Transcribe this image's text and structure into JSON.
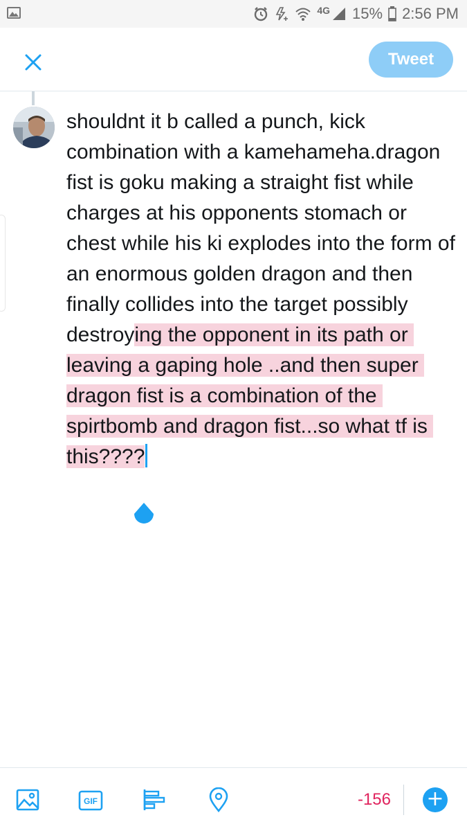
{
  "status_bar": {
    "battery": "15%",
    "time": "2:56 PM",
    "network": "4G",
    "icons": [
      "gallery-icon",
      "alarm-icon",
      "data-saver-icon",
      "wifi-icon",
      "signal-icon",
      "battery-icon"
    ]
  },
  "header": {
    "close_icon": "close-icon",
    "tweet_label": "Tweet",
    "tweet_button_color": "#8ecdf7"
  },
  "compose": {
    "text_plain": "shouldnt it b called a punch, kick combination with a kamehameha.dragon fist is goku making a straight fist while charges at his opponents stomach or chest while his ki explodes into the form of an enormous golden dragon and then finally collides into the target possibly destroy",
    "text_selected": "ing the opponent in its path or leaving a gaping hole ..and then super dragon fist is a combination of the spirtbomb and dragon fist...so what tf is this????",
    "selection_color": "#f7d3dd",
    "cursor_color": "#1da1f2"
  },
  "toolbar": {
    "icons": [
      "image-icon",
      "gif-icon",
      "poll-icon",
      "location-icon"
    ],
    "gif_label": "GIF",
    "char_counter": "-156",
    "counter_color": "#e0245e",
    "add_label": "+"
  }
}
